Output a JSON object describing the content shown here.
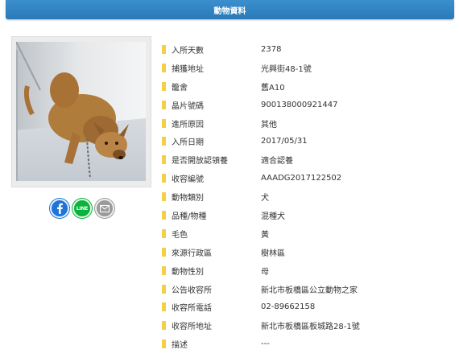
{
  "header": {
    "title": "動物資料"
  },
  "photo": {
    "alt": "dog-photo"
  },
  "share": {
    "icons": [
      "facebook-icon",
      "line-icon",
      "mail-icon"
    ],
    "line_text": "LINE"
  },
  "fields": [
    {
      "label": "入所天數",
      "value": "2378"
    },
    {
      "label": "捕獲地址",
      "value": "光興街48-1號"
    },
    {
      "label": "籠舍",
      "value": "舊A10"
    },
    {
      "label": "晶片號碼",
      "value": "900138000921447"
    },
    {
      "label": "進所原因",
      "value": "其他"
    },
    {
      "label": "入所日期",
      "value": "2017/05/31"
    },
    {
      "label": "是否開放認領養",
      "value": "適合認養"
    },
    {
      "label": "收容編號",
      "value": "AAADG2017122502"
    },
    {
      "label": "動物類別",
      "value": "犬"
    },
    {
      "label": "品種/物種",
      "value": "混種犬"
    },
    {
      "label": "毛色",
      "value": "黃"
    },
    {
      "label": "來源行政區",
      "value": "樹林區"
    },
    {
      "label": "動物性別",
      "value": "母"
    },
    {
      "label": "公告收容所",
      "value": "新北市板橋區公立動物之家"
    },
    {
      "label": "收容所電話",
      "value": "02-89662158"
    },
    {
      "label": "收容所地址",
      "value": "新北市板橋區板城路28-1號"
    },
    {
      "label": "描述",
      "value": "---"
    }
  ],
  "colors": {
    "header": "#2a79b8",
    "marker": "#f5d044",
    "facebook": "#1f74d7",
    "line": "#0ab33c",
    "mail": "#9a9a9a"
  }
}
